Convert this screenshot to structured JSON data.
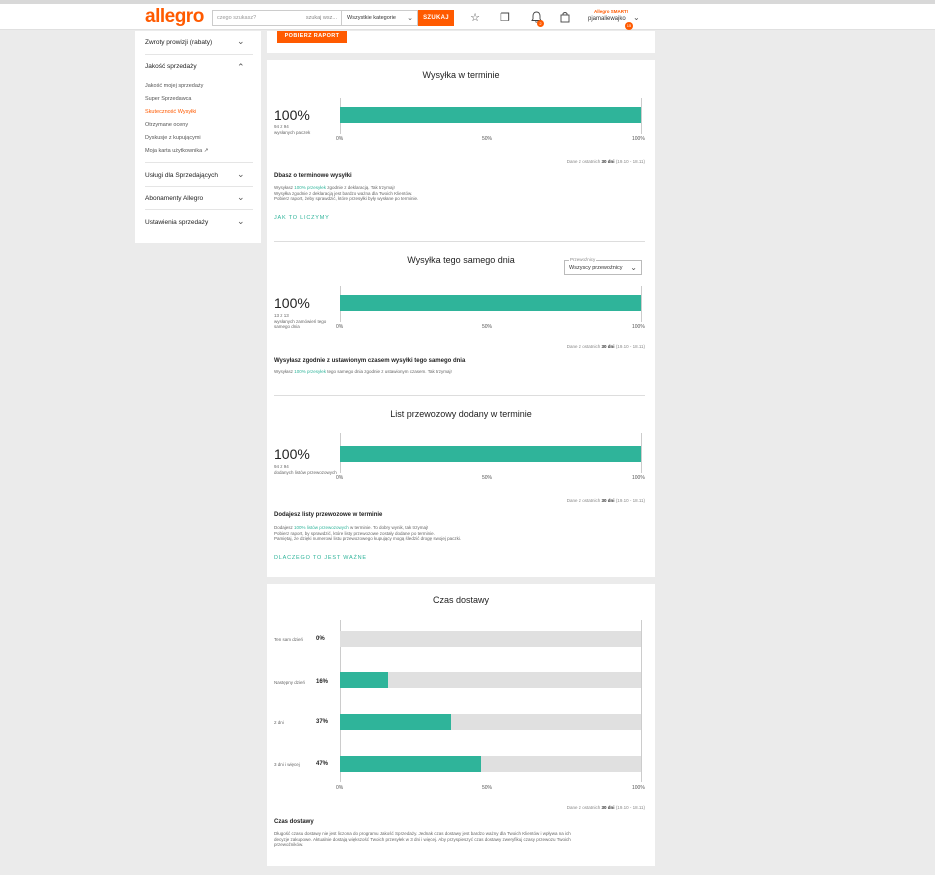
{
  "header": {
    "logo": "allegro",
    "search_placeholder": "czego szukasz?",
    "search_mode": "szukaj wsz...",
    "category": "Wszystkie kategorie",
    "search_button": "SZUKAJ",
    "smart_prefix": "Allegro",
    "smart_label": "SMART!",
    "username": "pjamaliewajko",
    "notifications_count": "2",
    "user_badge": "15",
    "accent_color": "#ff5a00"
  },
  "sidebar": {
    "items": [
      {
        "label": "Zwroty prowizji (rabaty)"
      },
      {
        "label": "Jakość sprzedaży"
      },
      {
        "label": "Usługi dla Sprzedających"
      },
      {
        "label": "Abonamenty Allegro"
      },
      {
        "label": "Ustawienia sprzedaży"
      }
    ],
    "sub_items": [
      {
        "label": "Jakość mojej sprzedaży"
      },
      {
        "label": "Super Sprzedawca"
      },
      {
        "label": "Skuteczność Wysyłki"
      },
      {
        "label": "Otrzymane oceny"
      },
      {
        "label": "Dyskusje z kupującymi"
      },
      {
        "label": "Moja karta użytkownika"
      }
    ]
  },
  "report_button": "POBIERZ RAPORT",
  "axis": {
    "t0": "0%",
    "t50": "50%",
    "t100": "100%"
  },
  "dane": {
    "prefix": "Dane z ostatnich",
    "days": "30 dni",
    "range": "(19.10 - 18.11)"
  },
  "wysylka": {
    "title": "Wysyłka w terminie",
    "percent": "100%",
    "sub1": "94 z 94",
    "sub2": "wysłanych paczek",
    "value": 100,
    "heading": "Dbasz o terminowe wysyłki",
    "p1_a": "Wysyłasz ",
    "p1_b": "100% przesyłek",
    "p1_c": " zgodnie z deklaracją. Tak trzymaj!",
    "p2": "Wysyłka zgodnie z deklaracją jest bardzo ważna dla Twoich Klientów.",
    "p3": "Pobierz raport, żeby sprawdzić, które przesyłki były wysłane po terminie.",
    "link": "JAK TO LICZYMY"
  },
  "same_day": {
    "title": "Wysyłka tego samego dnia",
    "select_label": "Przewoźnicy",
    "select_value": "Wszyscy przewoźnicy",
    "percent": "100%",
    "sub1": "13 z 13",
    "sub2": "wysłanych zamówień tego samego dnia",
    "value": 100,
    "heading": "Wysyłasz zgodnie z ustawionym czasem wysyłki tego samego dnia",
    "p1_a": "Wysyłasz ",
    "p1_b": "100% przesyłek",
    "p1_c": " tego samego dnia zgodnie z ustawionym czasem. Tak trzymaj!"
  },
  "list": {
    "title": "List przewozowy dodany w terminie",
    "percent": "100%",
    "sub1": "94 z 94",
    "sub2": "dodanych listów przewozowych",
    "value": 100,
    "heading": "Dodajesz listy przewozowe w terminie",
    "p1_a": "Dodajesz ",
    "p1_b": "100% listów przewozowych",
    "p1_c": " w terminie. To dobry wynik, tak trzymaj!",
    "p2": "Pobierz raport, by sprawdzić, które listy przewozowe zostały dodane po terminie.",
    "p3": "Pamiętaj, że dzięki numerowi listu przewozowego kupujący mogą śledzić drogę swojej paczki.",
    "link": "DLACZEGO TO JEST WAŻNE"
  },
  "czas": {
    "title": "Czas dostawy",
    "rows": [
      {
        "label": "Ten sam dzień",
        "percent": "0%",
        "value": 0
      },
      {
        "label": "Następny dzień",
        "percent": "16%",
        "value": 16
      },
      {
        "label": "2 dni",
        "percent": "37%",
        "value": 37
      },
      {
        "label": "3 dni i więcej",
        "percent": "47%",
        "value": 47
      }
    ],
    "heading": "Czas dostawy",
    "p1": "Długość czasu dostawy nie jest liczona do programu Jakość Sprzedaży. Jednak czas dostawy jest bardzo ważny dla Twoich Klientów i wpływa na ich",
    "p2": "decyzje zakupowe. Aktualnie dostają większość Twoich przesyłek w 3 dni i więcej. Aby przyspieszyć czas dostawy zweryfikuj czasy przewozu Twoich",
    "p3": "przewoźników."
  },
  "chart_data": [
    {
      "type": "bar",
      "title": "Wysyłka w terminie",
      "categories": [
        ""
      ],
      "values": [
        100
      ],
      "xlim": [
        0,
        100
      ],
      "xlabel": "",
      "ylabel": ""
    },
    {
      "type": "bar",
      "title": "Wysyłka tego samego dnia",
      "categories": [
        ""
      ],
      "values": [
        100
      ],
      "xlim": [
        0,
        100
      ],
      "xlabel": "",
      "ylabel": ""
    },
    {
      "type": "bar",
      "title": "List przewozowy dodany w terminie",
      "categories": [
        ""
      ],
      "values": [
        100
      ],
      "xlim": [
        0,
        100
      ],
      "xlabel": "",
      "ylabel": ""
    },
    {
      "type": "bar",
      "title": "Czas dostawy",
      "categories": [
        "Ten sam dzień",
        "Następny dzień",
        "2 dni",
        "3 dni i więcej"
      ],
      "values": [
        0,
        16,
        37,
        47
      ],
      "xlim": [
        0,
        100
      ],
      "xlabel": "",
      "ylabel": ""
    }
  ]
}
